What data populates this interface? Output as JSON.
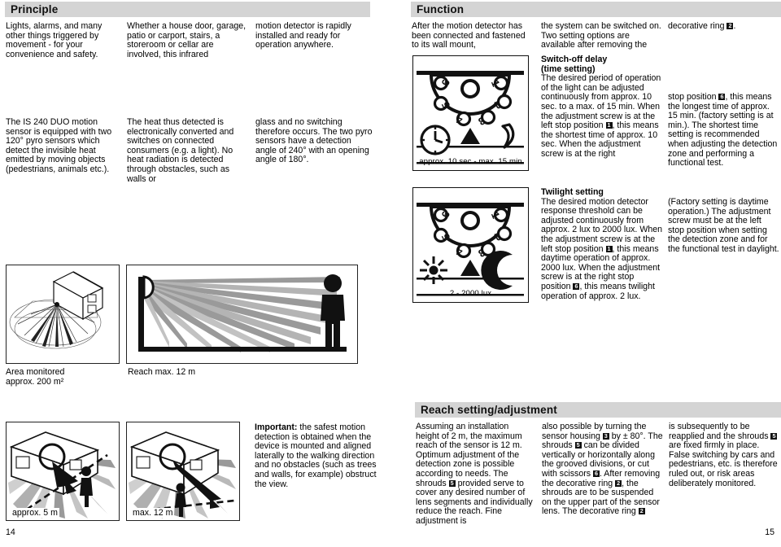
{
  "sections": {
    "principle": {
      "title": "Principle"
    },
    "function": {
      "title": "Function"
    },
    "reach": {
      "title": "Reach setting/adjustment"
    }
  },
  "principle": {
    "col1_a": "Lights, alarms, and many other things triggered by movement - for your convenience and safety.",
    "col1_b": "The IS 240 DUO motion sensor is equipped with two 120° pyro sensors which detect the invisible heat emitted by moving objects (pedestrians, animals etc.).",
    "col2_a": "Whether a house door, garage, patio or carport, stairs, a storeroom or cellar are involved, this infrared",
    "col2_b": "The heat thus detected is electronically converted and switches on connected consumers (e.g. a light). No heat radiation is detected through obstacles, such as walls or",
    "col3_a": "motion detector is rapidly installed and ready for operation anywhere.",
    "col3_b": "glass and no switching therefore occurs. The two pyro sensors have a detection angle of 240° with an opening angle of 180°."
  },
  "function": {
    "col4_a": "After the motion detector has been connected and fastened to its wall mount,",
    "col5_a": "the system can be switched on. Two setting options are available after removing the",
    "col6_a_pre": "decorative ring ",
    "col6_a_badge": "2",
    "col6_a_post": ".",
    "switchoff_heading_line1": "Switch-off delay",
    "switchoff_heading_line2": "(time setting)",
    "switchoff_body_1": "The desired period of operation of the light can be adjusted continuously from approx. 10 sec. to a max. of 15 min. When the adjustment screw is at the left stop position ",
    "switchoff_badge_1": "1",
    "switchoff_body_2": ", this means the shortest time of approx. 10 sec. When the adjustment screw is at the right",
    "switchoff_right_1": "stop position ",
    "switchoff_right_badge": "6",
    "switchoff_right_2": ", this means the longest time of approx. 15 min. (factory setting is at min.). The shortest time setting is recommended when adjusting the detection zone and performing a functional test.",
    "twilight_heading": "Twilight setting",
    "twilight_body_1": "The desired motion detector response threshold can be adjusted continuously from approx. 2 lux to 2000 lux. When the adjustment screw is at the left stop position ",
    "twilight_badge_1": "1",
    "twilight_body_2": ", this means daytime operation of approx. 2000 lux. When the adjustment screw is at the right stop position ",
    "twilight_badge_2": "6",
    "twilight_body_3": ", this means twilight operation of approx. 2 lux.",
    "twilight_right": "(Factory setting is daytime operation.) The adjustment screw must be at the left stop position when setting the detection zone and for the functional test in daylight."
  },
  "dials": {
    "time": {
      "label": "approx. 10 sec - max. 15 min",
      "numbers": [
        "1",
        "2",
        "3",
        "4",
        "5",
        "6"
      ],
      "left_icon": "clock-icon",
      "right_icon": "moon-sliver-icon",
      "pointer": "triangle-pointer"
    },
    "twilight": {
      "label": "2 - 2000 lux",
      "numbers": [
        "1",
        "2",
        "3",
        "4",
        "5",
        "6"
      ],
      "left_icon": "sun-icon",
      "right_icon": "moon-icon",
      "pointer": "triangle-pointer"
    }
  },
  "figures": {
    "area_monitored": {
      "caption_line1": "Area monitored",
      "caption_line2": "approx. 200 m²",
      "name": "house-detection-zone-3d-diagram"
    },
    "reach_max": {
      "caption": "Reach max. 12 m",
      "name": "sensor-reach-side-view-diagram"
    },
    "approach_frontal": {
      "caption": "approx. 5 m",
      "name": "frontal-approach-diagram"
    },
    "approach_lateral": {
      "caption": "max. 12 m",
      "name": "lateral-approach-diagram"
    }
  },
  "important_note": {
    "label": "Important:",
    "body": " the safest motion detection is obtained when the device is mounted and aligned laterally to the walking direction and no obstacles (such as trees and walls, for example) obstruct the view."
  },
  "reach": {
    "col1_1": "Assuming an installation height of 2 m, the maximum reach of the sensor is 12 m. Optimum adjustment of the detection zone is possible according to needs. The shrouds ",
    "col1_badge": "5",
    "col1_2": " provided serve to cover any desired number of lens segments and individually reduce the reach. Fine adjustment is",
    "col2_1": "also possible by turning the sensor housing ",
    "col2_badge1": "3",
    "col2_2": " by ± 80°. The shrouds ",
    "col2_badge2": "5",
    "col2_3": " can be divided vertically or horizontally along the grooved divisions, or cut with scissors ",
    "col2_badge3": "6",
    "col2_4": ". After removing the decorative ring ",
    "col2_badge4": "2",
    "col2_5": ", the shrouds are to be suspended on the upper part of the sensor lens. The decorative ring ",
    "col2_badge5": "2",
    "col3_1": "is subsequently to be reapplied and the shrouds ",
    "col3_badge": "5",
    "col3_2": " are fixed firmly in place. False switching by cars and pedestrians, etc. is therefore ruled out, or risk areas deliberately monitored."
  },
  "page_numbers": {
    "left": "14",
    "right": "15"
  },
  "colors": {
    "bar_background": "#d4d4d4",
    "text": "#000000",
    "badge_background": "#111111",
    "beam_gray": "#9a9a9a",
    "beam_light": "#c9c9c9"
  }
}
